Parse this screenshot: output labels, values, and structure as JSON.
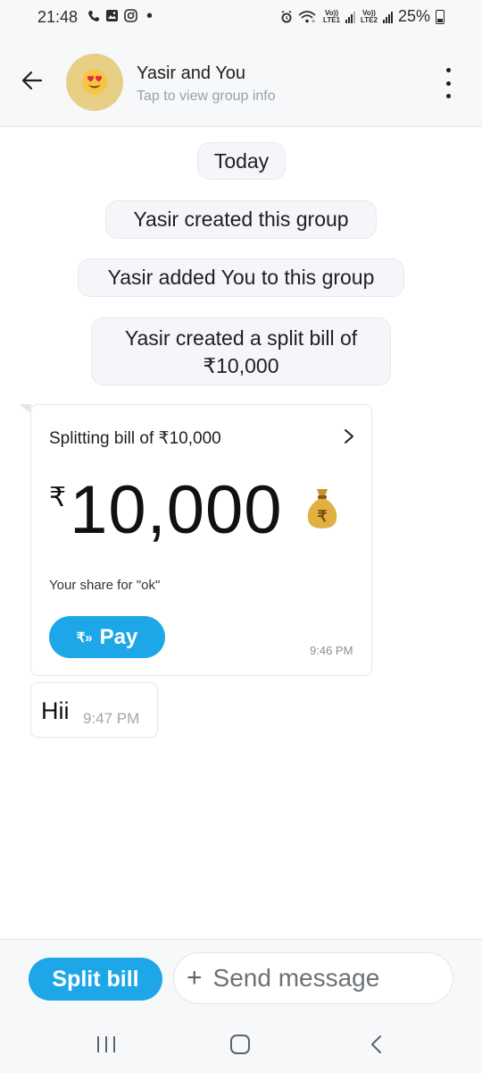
{
  "status_bar": {
    "time": "21:48",
    "battery": "25%",
    "sim1_label": "Vo))\nLTE1",
    "sim2_label": "Vo))\nLTE2"
  },
  "header": {
    "title": "Yasir and You",
    "subtitle": "Tap to view group info",
    "avatar_emoji": "😍"
  },
  "chat": {
    "system_messages": [
      "Today",
      "Yasir created this group",
      "Yasir added You to this group",
      "Yasir created a split bill of ₹10,000"
    ],
    "bill_card": {
      "title": "Splitting bill of ₹10,000",
      "currency": "₹",
      "amount": "10,000",
      "share_text": "Your share for \"ok\"",
      "pay_label": "Pay",
      "pay_icon": "₹»",
      "time": "9:46 PM"
    },
    "message": {
      "text": "Hii",
      "time": "9:47 PM"
    }
  },
  "composer": {
    "split_bill_label": "Split bill",
    "send_placeholder": "Send message",
    "plus": "+"
  },
  "colors": {
    "accent": "#1ea7e8",
    "avatar_bg": "#e8cf86"
  }
}
